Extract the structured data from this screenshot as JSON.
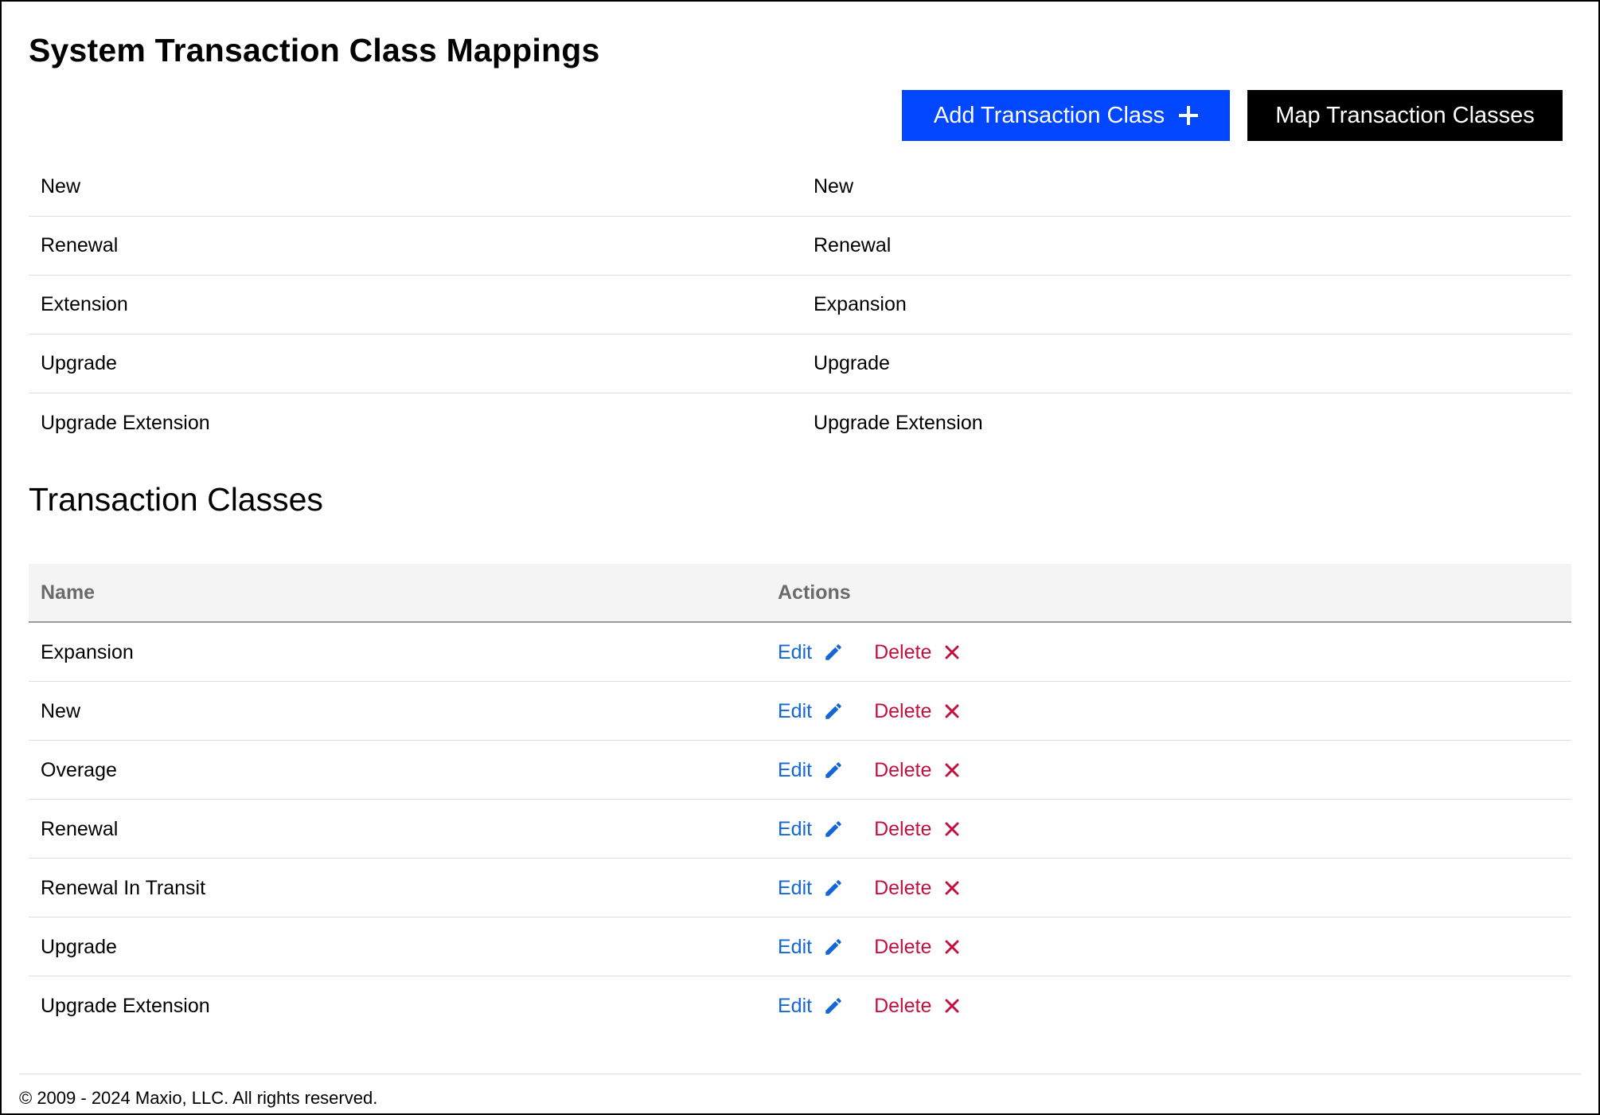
{
  "page": {
    "title": "System Transaction Class Mappings",
    "section_title": "Transaction Classes",
    "footer": "© 2009 - 2024 Maxio, LLC. All rights reserved."
  },
  "toolbar": {
    "add_label": "Add Transaction Class",
    "add_icon": "plus-icon",
    "map_label": "Map Transaction Classes"
  },
  "mappings": [
    {
      "system": "New",
      "mapped": "New"
    },
    {
      "system": "Renewal",
      "mapped": "Renewal"
    },
    {
      "system": "Extension",
      "mapped": "Expansion"
    },
    {
      "system": "Upgrade",
      "mapped": "Upgrade"
    },
    {
      "system": "Upgrade Extension",
      "mapped": "Upgrade Extension"
    }
  ],
  "classes_table": {
    "headers": {
      "name": "Name",
      "actions": "Actions"
    },
    "edit_label": "Edit",
    "delete_label": "Delete",
    "rows": [
      {
        "name": "Expansion"
      },
      {
        "name": "New"
      },
      {
        "name": "Overage"
      },
      {
        "name": "Renewal"
      },
      {
        "name": "Renewal In Transit"
      },
      {
        "name": "Upgrade"
      },
      {
        "name": "Upgrade Extension"
      }
    ]
  },
  "colors": {
    "primary_button": "#0047ff",
    "secondary_button": "#000000",
    "edit_link": "#1466d6",
    "delete_link": "#c2113f"
  }
}
